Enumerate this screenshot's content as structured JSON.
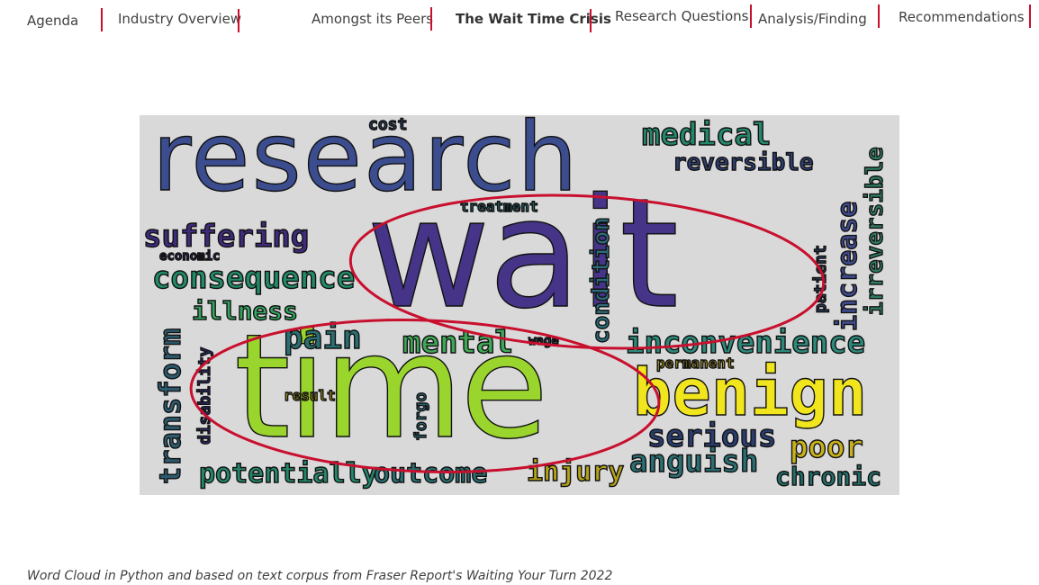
{
  "nav": {
    "agenda": "Agenda",
    "industry_overview": "Industry Overview",
    "amongst_peers": "Amongst its Peers",
    "wait_time_crisis": "The Wait Time Crisis",
    "research_questions": "Research Questions",
    "analysis_finding": "Analysis/Finding",
    "recommendations": "Recommendations"
  },
  "word_cloud": {
    "words": {
      "research": "research",
      "wait": "wait",
      "time": "time",
      "benign": "benign",
      "medical": "medical",
      "reversible": "reversible",
      "irreversible": "irreversible",
      "increase": "increase",
      "cost": "cost",
      "treatment": "treatment",
      "suffering": "suffering",
      "economic": "economic",
      "consequence": "consequence",
      "illness": "illness",
      "transform": "transform",
      "pain": "pain",
      "mental": "mental",
      "wage": "wage",
      "condition": "condition",
      "patient": "patient",
      "inconvenience": "inconvenience",
      "permanent": "permanent",
      "disability": "disability",
      "result": "result",
      "forgo": "forgo",
      "serious": "serious",
      "poor": "poor",
      "anguish": "anguish",
      "chronic": "chronic",
      "injury": "injury",
      "potentially": "potentially",
      "outcome": "outcome"
    },
    "highlight_color": "#c8102e"
  },
  "caption": "Word Cloud in Python and based on text corpus from Fraser Report's Waiting Your Turn 2022"
}
